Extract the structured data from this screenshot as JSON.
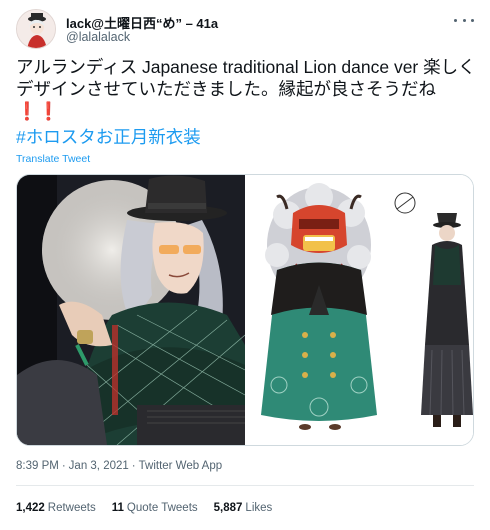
{
  "author": {
    "display_name": "lack@土曜日西“め” – 41a",
    "handle": "@lalalalack"
  },
  "tweet": {
    "text": "アルランディス Japanese traditional  Lion dance ver 楽しくデザインさせていただきました。縁起が良さそうだね",
    "emoji": "❗❗",
    "hashtag": "#ホロスタお正月新衣装",
    "translate_label": "Translate Tweet"
  },
  "meta": {
    "time": "8:39 PM",
    "date": "Jan 3, 2021",
    "source": "Twitter Web App"
  },
  "stats": {
    "retweets_count": "1,422",
    "retweets_label": "Retweets",
    "quotes_count": "11",
    "quotes_label": "Quote Tweets",
    "likes_count": "5,887",
    "likes_label": "Likes"
  },
  "icons": {
    "more": "more-dots-icon",
    "avatar": "avatar-image"
  },
  "colors": {
    "link": "#1d9bf0",
    "secondary_text": "#536471",
    "primary_text": "#0f1419",
    "emoji_red": "#e0261e"
  }
}
